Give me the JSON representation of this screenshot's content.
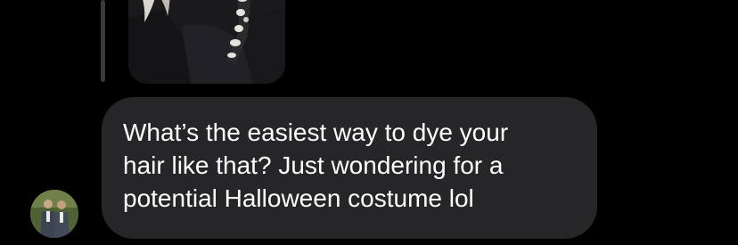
{
  "message": {
    "text": "What’s the easiest way to dye your\nhair like that? Just wondering for a\npotential Halloween costume lol"
  },
  "reply_preview": {
    "image_icon": "photo-thumbnail"
  },
  "sender": {
    "avatar_icon": "profile-photo"
  },
  "colors": {
    "background": "#000000",
    "bubble": "#262628",
    "text": "#ffffff",
    "reply_bar": "#3a3a3c"
  }
}
